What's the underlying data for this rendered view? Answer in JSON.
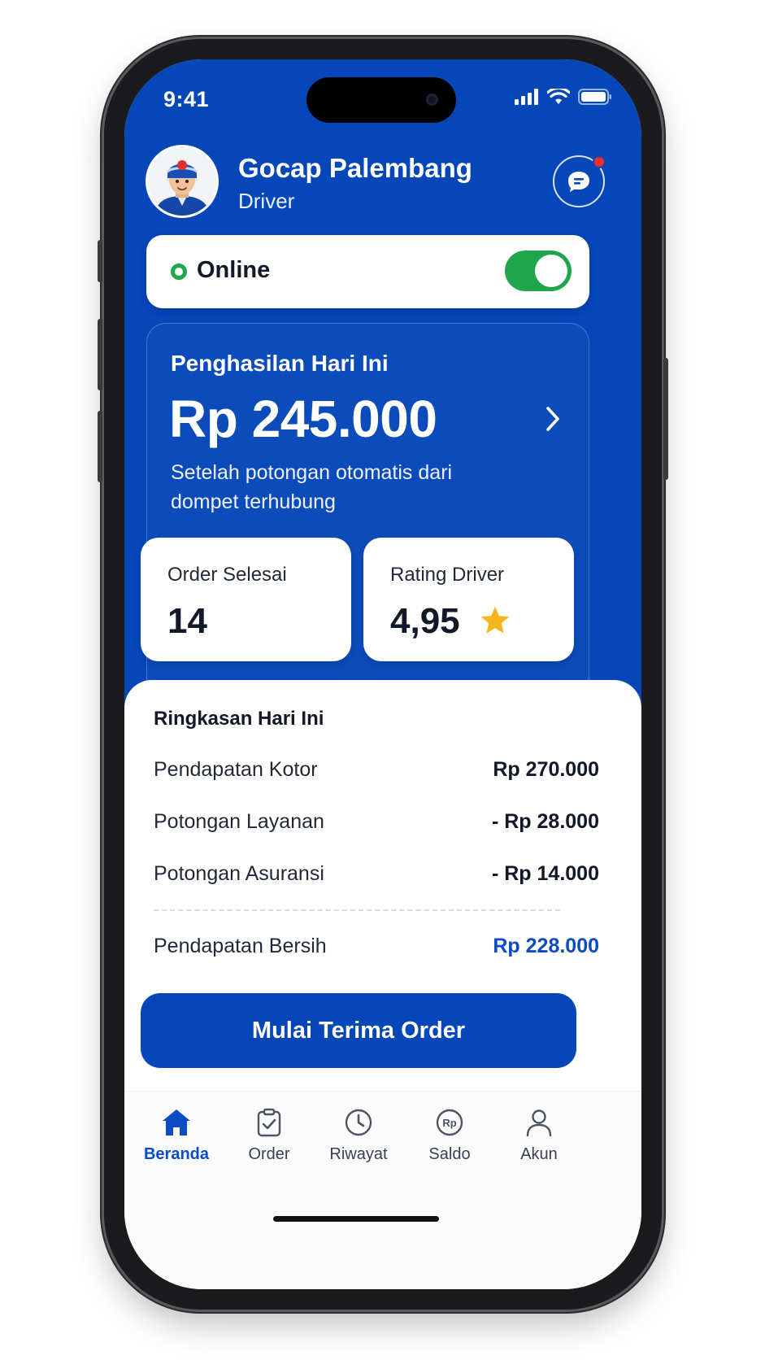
{
  "status_bar": {
    "time": "9:41"
  },
  "header": {
    "name": "Gocap Palembang",
    "role": "Driver",
    "notification_dot": true
  },
  "online": {
    "label": "Online",
    "toggle_on": true
  },
  "earnings": {
    "title": "Penghasilan Hari Ini",
    "amount": "Rp 245.000",
    "note": "Setelah potongan otomatis dari dompet terhubung"
  },
  "stats": [
    {
      "label": "Order Selesai",
      "value": "14"
    },
    {
      "label": "Rating Driver",
      "value": "4,95",
      "icon": "star-icon"
    }
  ],
  "summary": {
    "title": "Ringkasan Hari Ini",
    "rows": [
      {
        "label": "Pendapatan Kotor",
        "value": "Rp 270.000"
      },
      {
        "label": "Potongan Layanan",
        "value": "- Rp 28.000"
      },
      {
        "label": "Potongan Asuransi",
        "value": "- Rp 14.000"
      }
    ],
    "net": {
      "label": "Pendapatan Bersih",
      "value": "Rp 228.000"
    }
  },
  "cta": {
    "label": "Mulai Terima Order"
  },
  "tabs": [
    {
      "label": "Beranda",
      "icon": "home-icon",
      "active": true
    },
    {
      "label": "Order",
      "icon": "clipboard-check-icon",
      "active": false
    },
    {
      "label": "Riwayat",
      "icon": "clock-icon",
      "active": false
    },
    {
      "label": "Saldo",
      "icon": "rupiah-coin-icon",
      "active": false
    },
    {
      "label": "Akun",
      "icon": "user-icon",
      "active": false
    }
  ],
  "colors": {
    "primary_blue": "#0546b8",
    "online_green": "#20a64a",
    "star_yellow": "#f6b51e",
    "badge_red": "#ff2a2a"
  }
}
